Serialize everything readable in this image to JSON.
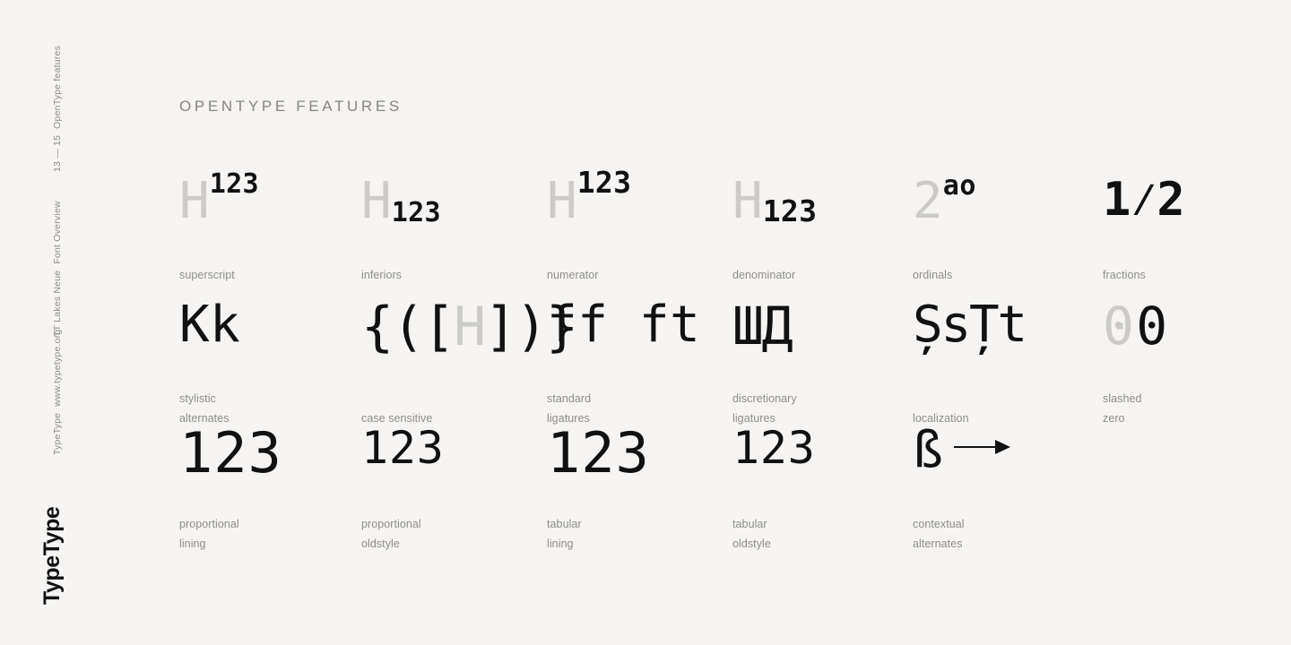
{
  "page": {
    "background_color": "#f5f4f2",
    "text_color": "#111111",
    "muted_color": "#8e8d8a",
    "glyph_gray_color": "#cccbc8"
  },
  "sidebar": {
    "section_number": "13 — 15",
    "section_name": "OpenType features",
    "font_name": "TT Lakes Neue",
    "document_name": "Font Overview",
    "company": "TypeType",
    "website": "www.typetype.org",
    "logo": "TypeType"
  },
  "main": {
    "title": "OPENTYPE FEATURES"
  },
  "features": [
    [
      {
        "id": "superscript",
        "caption": [
          "superscript"
        ],
        "base": "H",
        "mark": "123",
        "mark_style": "superscript"
      },
      {
        "id": "inferiors",
        "caption": [
          "inferiors"
        ],
        "base": "H",
        "mark": "123",
        "mark_style": "subscript"
      },
      {
        "id": "numerator",
        "caption": [
          "numerator"
        ],
        "base": "H",
        "mark": "123",
        "mark_style": "numerator"
      },
      {
        "id": "denominator",
        "caption": [
          "denominator"
        ],
        "base": "H",
        "mark": "123",
        "mark_style": "denominator"
      },
      {
        "id": "ordinals",
        "caption": [
          "ordinals"
        ],
        "base": "2",
        "mark": "ao",
        "mark_style": "ordinal"
      },
      {
        "id": "fractions",
        "caption": [
          "fractions"
        ],
        "glyphs": "1⁄2"
      }
    ],
    [
      {
        "id": "stylistic-alternates",
        "caption": [
          "stylistic",
          "alternates"
        ],
        "glyphs": "Кk"
      },
      {
        "id": "case-sensitive",
        "caption": [
          "case sensitive"
        ],
        "glyphs_before": "{([",
        "glyphs_gray": "H",
        "glyphs_after": "])}"
      },
      {
        "id": "standard-ligatures",
        "caption": [
          "standard",
          "ligatures"
        ],
        "glyphs": "ff ft"
      },
      {
        "id": "discretionary-ligatures",
        "caption": [
          "discretionary",
          "ligatures"
        ],
        "glyphs": "ШД"
      },
      {
        "id": "localization",
        "caption": [
          "localization"
        ],
        "glyphs": "ȘsȚt"
      },
      {
        "id": "slashed-zero",
        "caption": [
          "slashed",
          "zero"
        ],
        "glyphs_gray": "0",
        "glyphs": "0"
      }
    ],
    [
      {
        "id": "proportional-lining",
        "caption": [
          "proportional",
          "lining"
        ],
        "glyphs": "123",
        "size": "large"
      },
      {
        "id": "proportional-oldstyle",
        "caption": [
          "proportional",
          "oldstyle"
        ],
        "glyphs": "123",
        "size": "small"
      },
      {
        "id": "tabular-lining",
        "caption": [
          "tabular",
          "lining"
        ],
        "glyphs": "123",
        "size": "large"
      },
      {
        "id": "tabular-oldstyle",
        "caption": [
          "tabular",
          "oldstyle"
        ],
        "glyphs": "123",
        "size": "small"
      },
      {
        "id": "contextual-alternates",
        "caption": [
          "contextual",
          "alternates"
        ],
        "glyphs": "ß",
        "arrow": "right-arrow"
      }
    ]
  ]
}
